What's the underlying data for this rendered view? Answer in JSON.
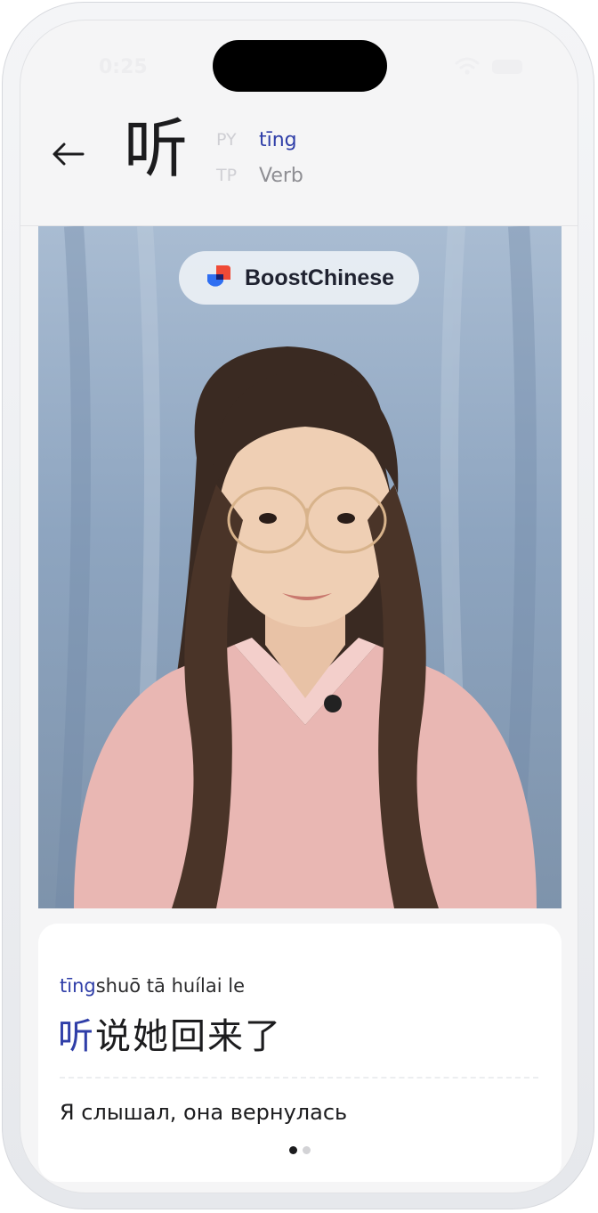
{
  "status_bar": {
    "time": "0:25"
  },
  "header": {
    "back_icon": "arrow-left-icon",
    "character": "听",
    "pinyin_key": "PY",
    "pinyin_value": "tīng",
    "type_key": "TP",
    "type_value": "Verb"
  },
  "video": {
    "brand_name": "BoostChinese",
    "brand_icon": "boostchinese-logo-icon"
  },
  "example": {
    "pinyin_highlight": "tīng",
    "pinyin_rest": "shuō tā huílai le",
    "hanzi_highlight": "听",
    "hanzi_rest": "说她回来了",
    "translation": "Я слышал, она вернулась"
  },
  "pagination": {
    "total": 2,
    "current": 1
  },
  "colors": {
    "accent": "#2f3ea8",
    "text": "#1c1c1e",
    "muted": "#8e8e93"
  }
}
